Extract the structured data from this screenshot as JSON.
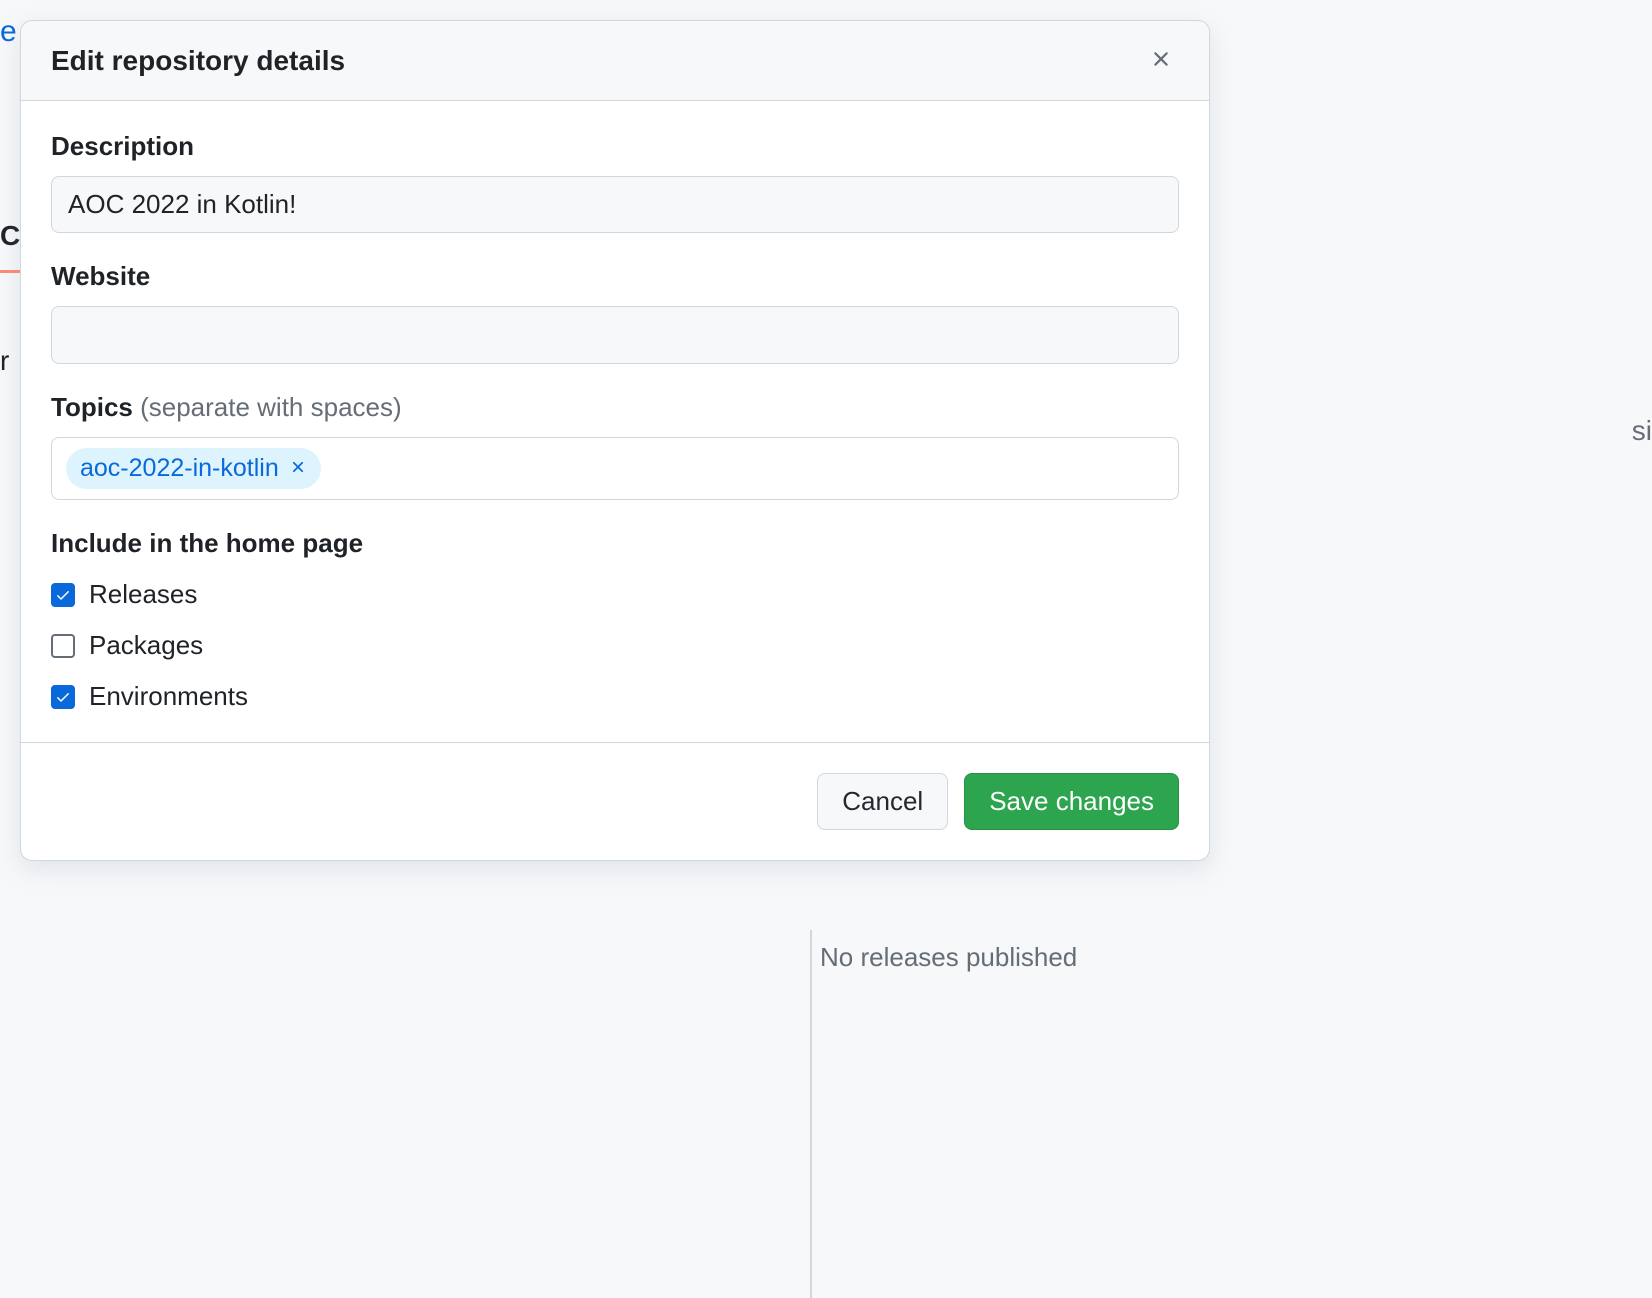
{
  "modal": {
    "title": "Edit repository details",
    "description": {
      "label": "Description",
      "value": "AOC 2022 in Kotlin!"
    },
    "website": {
      "label": "Website",
      "value": ""
    },
    "topics": {
      "label": "Topics",
      "hint": "(separate with spaces)",
      "items": [
        {
          "name": "aoc-2022-in-kotlin"
        }
      ]
    },
    "include_section": {
      "title": "Include in the home page",
      "options": [
        {
          "label": "Releases",
          "checked": true
        },
        {
          "label": "Packages",
          "checked": false
        },
        {
          "label": "Environments",
          "checked": true
        }
      ]
    },
    "footer": {
      "cancel": "Cancel",
      "save": "Save changes"
    }
  },
  "background": {
    "text_e": "e",
    "text_co": "Co",
    "text_r": "r",
    "text_si": "si",
    "releases_text": "No releases published"
  }
}
